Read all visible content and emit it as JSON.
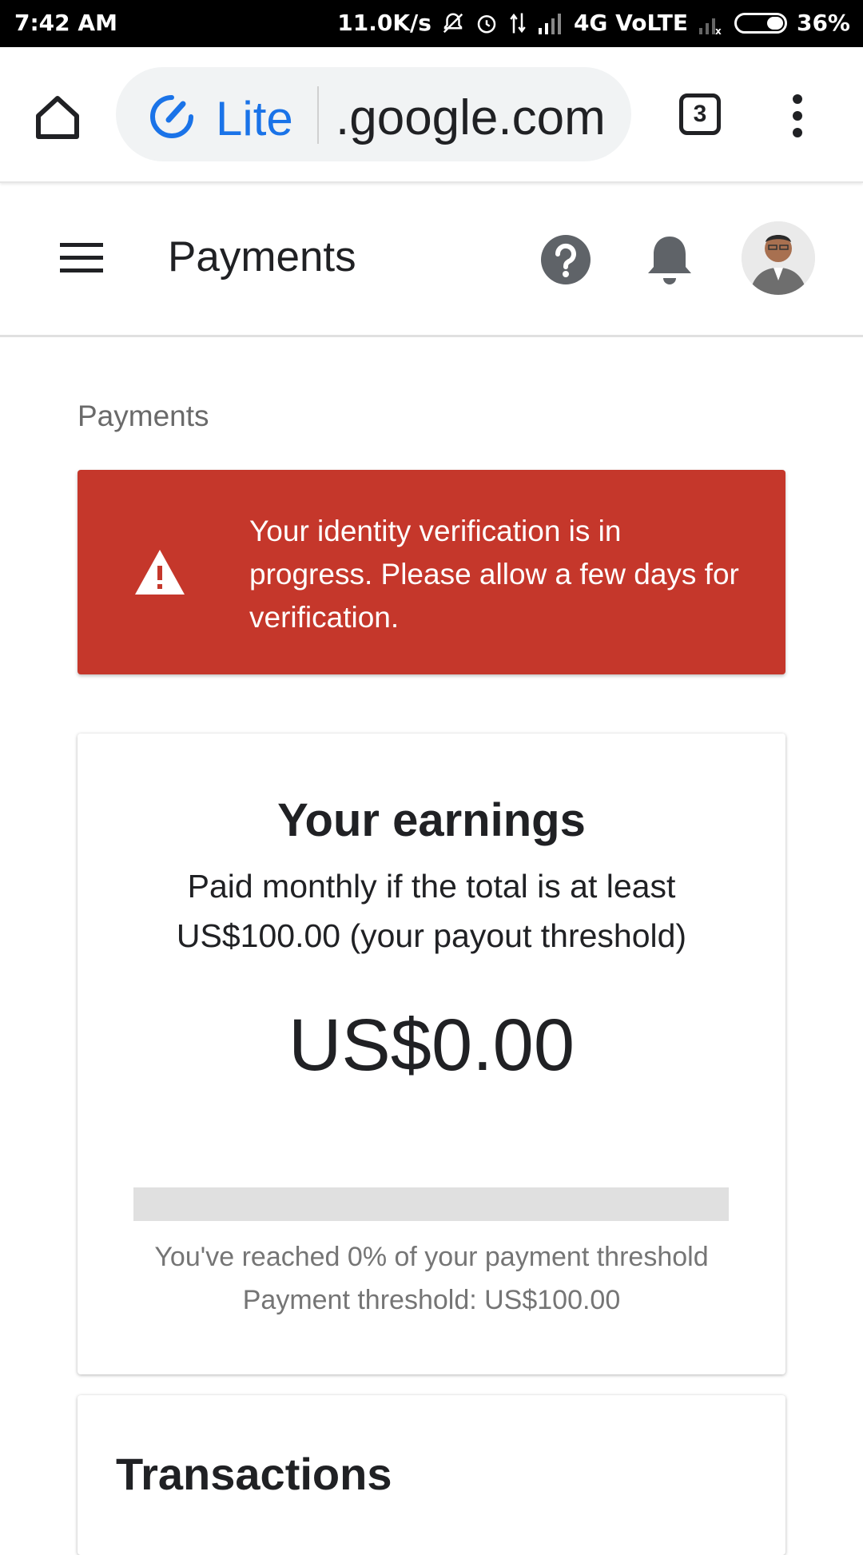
{
  "status_bar": {
    "time": "7:42 AM",
    "speed": "11.0K/s",
    "network": "4G VoLTE",
    "battery": "36%",
    "battery_level": 0.36,
    "icons": [
      "mute-icon",
      "alarm-icon",
      "data-arrows-icon",
      "signal-icon",
      "signal-no-service-icon",
      "battery-icon"
    ]
  },
  "browser": {
    "lite_label": "Lite",
    "url": ".google.com",
    "tab_count": "3",
    "accent_color": "#1a73e8",
    "icons": [
      "home-icon",
      "lite-speed-icon",
      "tabs-icon",
      "more-vert-icon"
    ]
  },
  "app_bar": {
    "title": "Payments",
    "icons": [
      "menu-icon",
      "help-icon",
      "notifications-icon",
      "avatar"
    ]
  },
  "breadcrumb": "Payments",
  "alert": {
    "message": "Your identity verification is in progress. Please allow a few days for verification.",
    "color": "#c5372b",
    "icon": "warning-icon"
  },
  "earnings": {
    "title": "Your earnings",
    "subtitle": "Paid monthly if the total is at least US$100.00 (your payout threshold)",
    "amount": "US$0.00",
    "progress_fraction": 0.0,
    "progress_text": "You've reached 0% of your payment threshold",
    "threshold_text": "Payment threshold: US$100.00"
  },
  "transactions": {
    "title": "Transactions"
  }
}
